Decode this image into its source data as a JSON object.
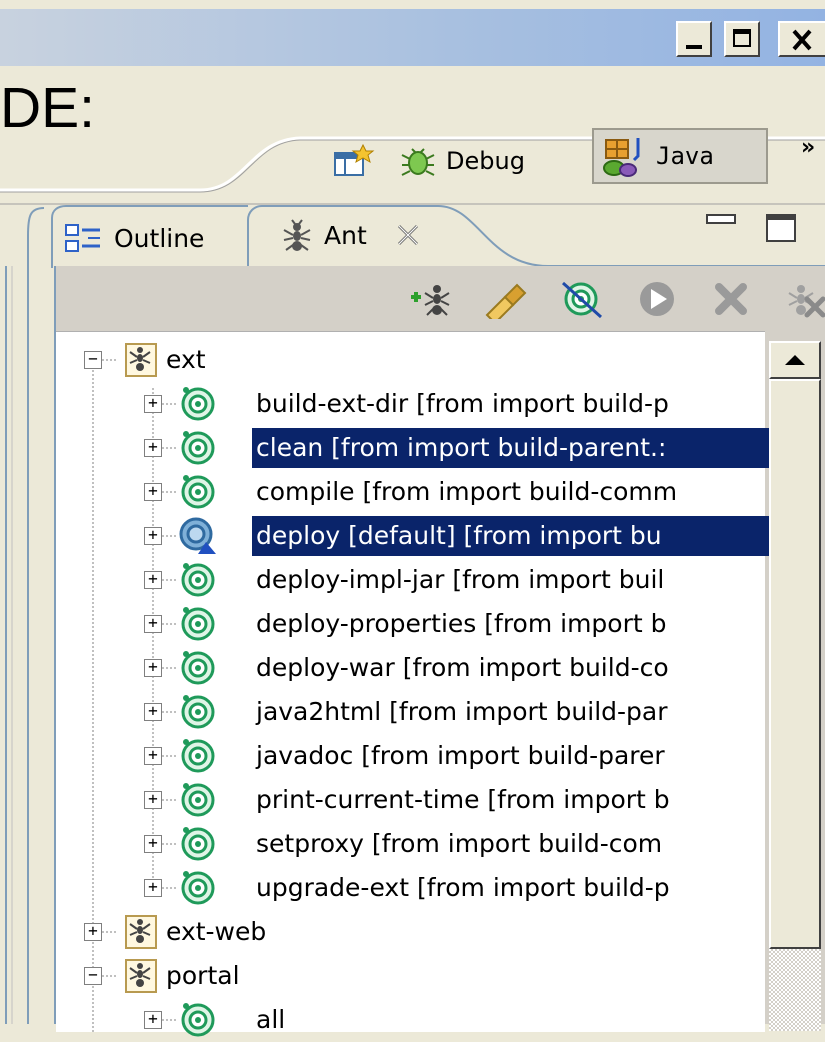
{
  "window": {
    "minimize": "_",
    "maximize": "☐",
    "close": "X"
  },
  "heading": "DE:",
  "perspectives": {
    "debug_label": "Debug",
    "java_label": "Java",
    "more": "»"
  },
  "tabs": {
    "outline": "Outline",
    "ant": "Ant"
  },
  "ant_toolbar": [
    "add-buildfile",
    "search-buildfile",
    "hide-internal-targets",
    "run-target",
    "remove-buildfile",
    "remove-all-buildfiles"
  ],
  "tree": {
    "projects": [
      {
        "name": "ext",
        "expanded": true,
        "targets": [
          {
            "label": "build-ext-dir [from import build-p",
            "selected": false,
            "default": false
          },
          {
            "label": "clean [from import build-parent.:",
            "selected": true,
            "default": false
          },
          {
            "label": "compile [from import build-comm",
            "selected": false,
            "default": false
          },
          {
            "label": "deploy [default] [from import bu",
            "selected": true,
            "default": true
          },
          {
            "label": "deploy-impl-jar [from import buil",
            "selected": false,
            "default": false
          },
          {
            "label": "deploy-properties [from import b",
            "selected": false,
            "default": false
          },
          {
            "label": "deploy-war [from import build-co",
            "selected": false,
            "default": false
          },
          {
            "label": "java2html [from import build-par",
            "selected": false,
            "default": false
          },
          {
            "label": "javadoc [from import build-parer",
            "selected": false,
            "default": false
          },
          {
            "label": "print-current-time [from import b",
            "selected": false,
            "default": false
          },
          {
            "label": "setproxy [from import build-com",
            "selected": false,
            "default": false
          },
          {
            "label": "upgrade-ext [from import build-p",
            "selected": false,
            "default": false
          }
        ]
      },
      {
        "name": "ext-web",
        "expanded": false,
        "targets": []
      },
      {
        "name": "portal",
        "expanded": true,
        "targets": [
          {
            "label": "all",
            "selected": false,
            "default": false
          }
        ]
      }
    ]
  },
  "colors": {
    "selection": "#0a246a",
    "target_green": "#1f9a5a",
    "title_blue": "#a8c0e0"
  }
}
